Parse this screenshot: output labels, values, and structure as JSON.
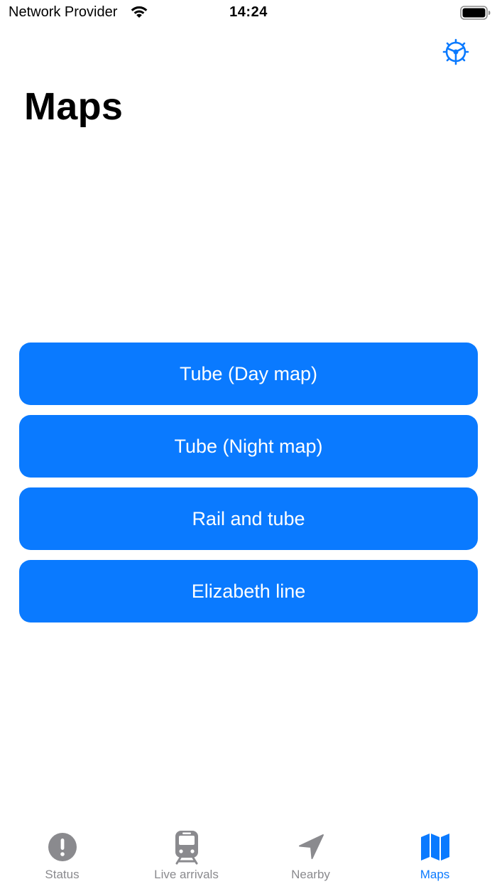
{
  "status_bar": {
    "carrier": "Network Provider",
    "time": "14:24",
    "wifi_icon": "wifi-icon",
    "battery_icon": "battery-icon"
  },
  "nav": {
    "settings_icon": "settings-icon",
    "title": "Maps"
  },
  "map_buttons": [
    {
      "label": "Tube (Day map)"
    },
    {
      "label": "Tube (Night map)"
    },
    {
      "label": "Rail and tube"
    },
    {
      "label": "Elizabeth line"
    }
  ],
  "tabs": [
    {
      "label": "Status",
      "icon": "exclamation-circle-icon",
      "active": false
    },
    {
      "label": "Live arrivals",
      "icon": "tram-icon",
      "active": false
    },
    {
      "label": "Nearby",
      "icon": "location-arrow-icon",
      "active": false
    },
    {
      "label": "Maps",
      "icon": "map-icon",
      "active": true
    }
  ],
  "colors": {
    "accent": "#0a7aff",
    "tab_inactive": "#8a8a8e",
    "background": "#ffffff"
  }
}
